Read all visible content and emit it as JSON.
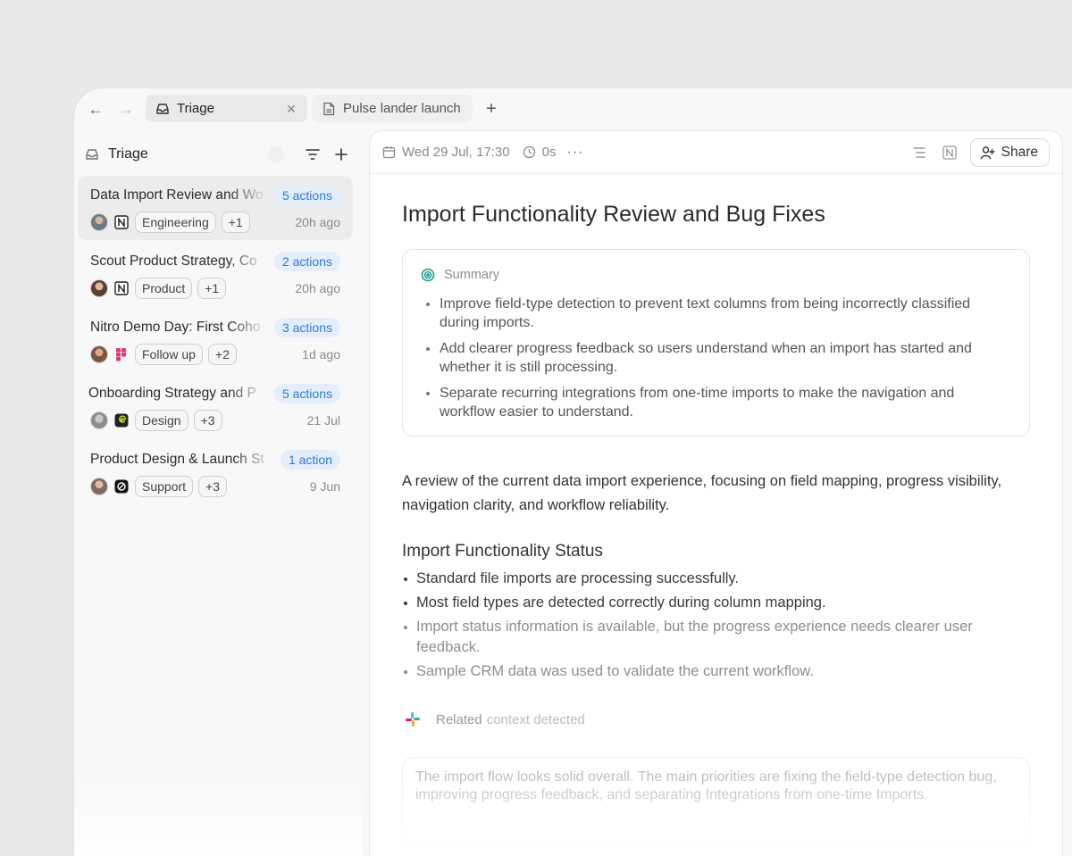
{
  "tabs": [
    {
      "label": "Triage",
      "icon": "inbox-icon",
      "active": true
    },
    {
      "label": "Pulse lander launch st",
      "icon": "document-icon",
      "active": false
    }
  ],
  "sidebar": {
    "title": "Triage",
    "items": [
      {
        "title": "Data Import Review and Wo",
        "badge": "5 actions",
        "app": "notion-icon",
        "chip": "Engineering",
        "extra": "+1",
        "time": "20h ago"
      },
      {
        "title": "Scout Product Strategy, Co",
        "badge": "2 actions",
        "app": "notion-icon",
        "chip": "Product",
        "extra": "+1",
        "time": "20h ago"
      },
      {
        "title": "Nitro Demo Day: First Coho",
        "badge": "3 actions",
        "app": "figma-icon",
        "chip": "Follow up",
        "extra": "+2",
        "time": "1d ago"
      },
      {
        "title": "Onboarding Strategy and P",
        "badge": "5 actions",
        "app": "spiral-icon",
        "chip": "Design",
        "extra": "+3",
        "time": "21 Jul"
      },
      {
        "title": "Product Design & Launch St",
        "badge": "1 action",
        "app": "openai-icon",
        "chip": "Support",
        "extra": "+3",
        "time": "9 Jun"
      }
    ]
  },
  "header": {
    "date": "Wed 29 Jul, 17:30",
    "duration": "0s",
    "more": "···",
    "share_label": "Share"
  },
  "doc": {
    "title": "Import Functionality Review and Bug Fixes",
    "summary_label": "Summary",
    "summary_items": [
      "Improve field-type detection to prevent text columns from being incorrectly classified during imports.",
      "Add clearer progress feedback so users understand when an import has started and whether it is still processing.",
      "Separate recurring integrations from one-time imports to make the navigation and workflow easier to understand."
    ],
    "intro": "A review of the current data import experience, focusing on field mapping, progress visibility, navigation clarity, and workflow reliability.",
    "section_title": "Import Functionality Status",
    "status_items": [
      "Standard file imports are processing successfully.",
      "Most field types are detected correctly during column mapping.",
      "Import status information is available, but the progress experience needs clearer user feedback.",
      "Sample CRM data was used to validate the current workflow."
    ],
    "related_a": "Related",
    "related_b": "context detected",
    "quote": "The import flow looks solid overall. The main priorities are fixing the field-type detection bug, improving progress feedback, and separating Integrations from one-time Imports."
  },
  "colors": {
    "accent_badge_bg": "#e4eefb",
    "accent_badge_text": "#2f7ad9",
    "summary_icon": "#1a9e8f"
  }
}
